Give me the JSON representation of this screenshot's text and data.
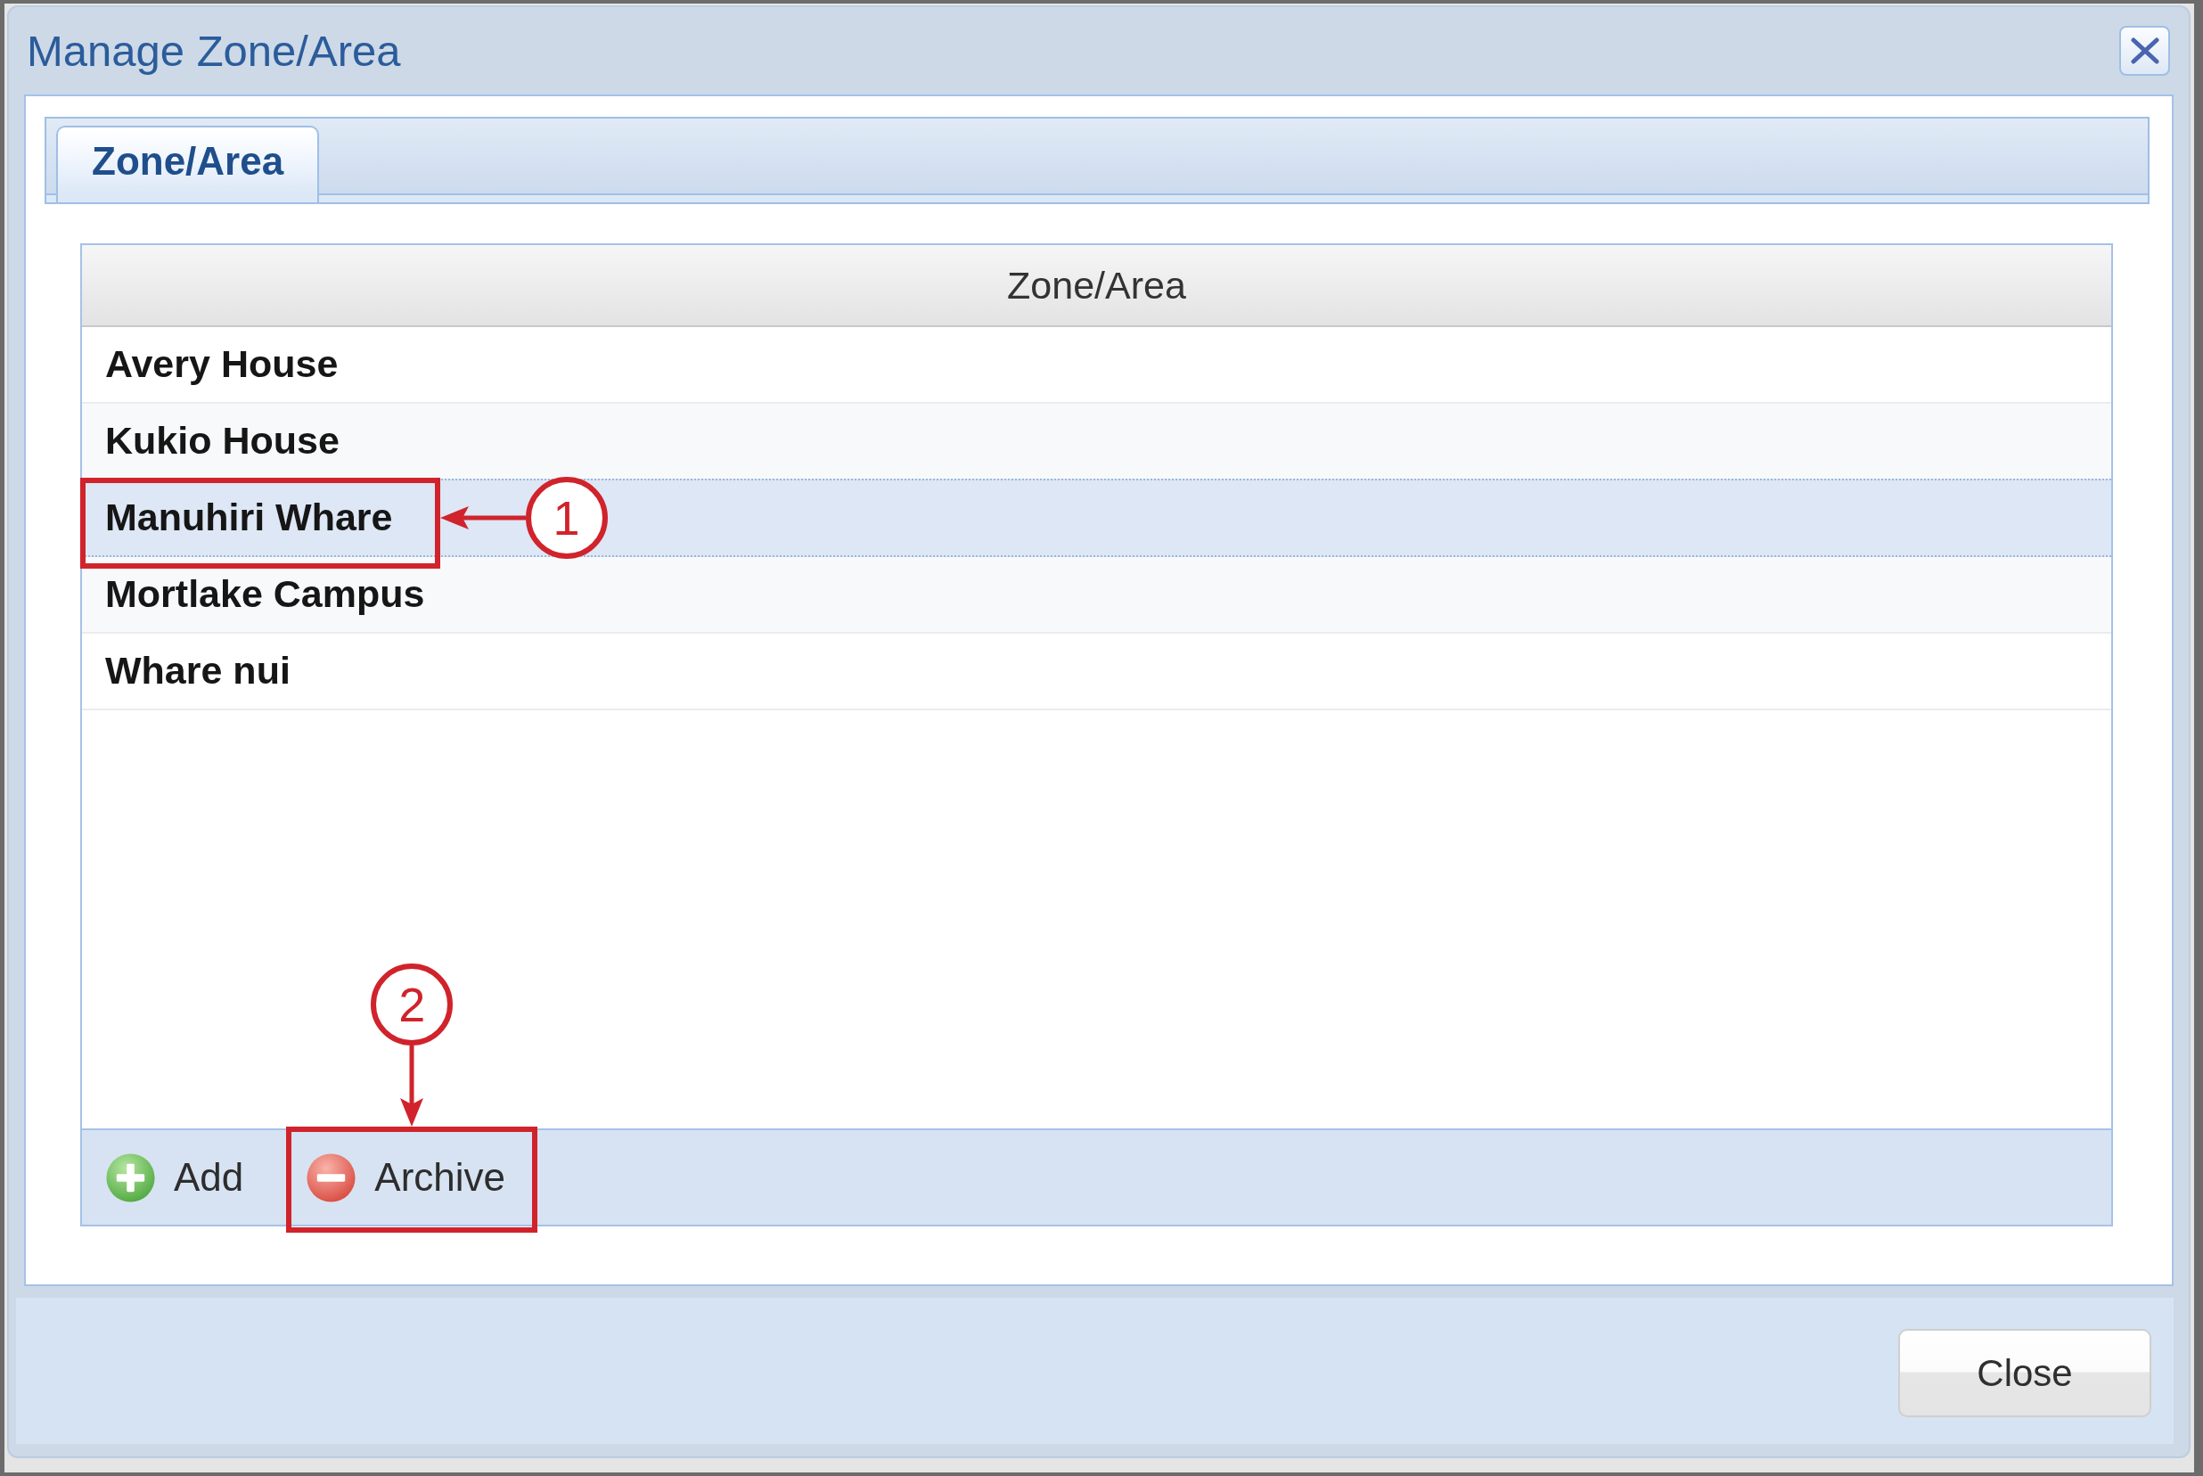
{
  "window": {
    "title": "Manage Zone/Area"
  },
  "tabs": [
    {
      "label": "Zone/Area",
      "selected": true
    }
  ],
  "grid": {
    "columns": [
      "Zone/Area"
    ],
    "rows": [
      {
        "name": "Avery House",
        "selected": false
      },
      {
        "name": "Kukio House",
        "selected": false
      },
      {
        "name": "Manuhiri Whare",
        "selected": true,
        "callout": "1"
      },
      {
        "name": "Mortlake Campus",
        "selected": false
      },
      {
        "name": "Whare nui",
        "selected": false
      }
    ],
    "toolbar": [
      {
        "kind": "add",
        "label": "Add"
      },
      {
        "kind": "archive",
        "label": "Archive",
        "callout": "2"
      }
    ]
  },
  "footer": {
    "buttons": [
      "Close"
    ]
  }
}
